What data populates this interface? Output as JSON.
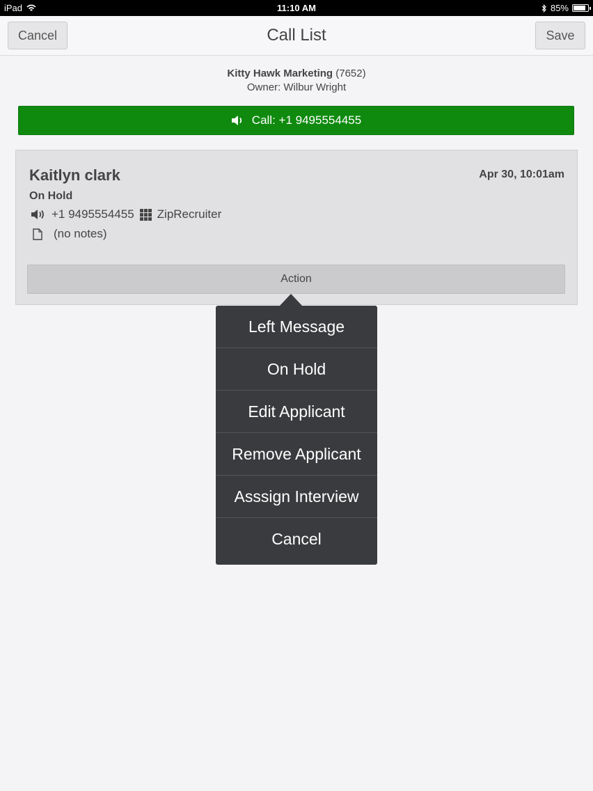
{
  "status_bar": {
    "device": "iPad",
    "time": "11:10 AM",
    "battery": "85%",
    "battery_level": 0.85
  },
  "navbar": {
    "title": "Call List",
    "cancel_label": "Cancel",
    "save_label": "Save"
  },
  "company": {
    "name": "Kitty Hawk Marketing",
    "id": "(7652)",
    "owner": "Owner: Wilbur Wright"
  },
  "call_button": {
    "label": "Call: +1 9495554455",
    "icon": "speaker-icon",
    "color": "#0f8a0f"
  },
  "contact": {
    "name": "Kaitlyn clark",
    "date": "Apr 30, 10:01am",
    "status": "On Hold",
    "phone": "+1 9495554455",
    "source": "ZipRecruiter",
    "notes": "(no notes)"
  },
  "action_button": {
    "label": "Action"
  },
  "action_menu": {
    "items": [
      {
        "label": "Left Message"
      },
      {
        "label": "On Hold"
      },
      {
        "label": "Edit Applicant"
      },
      {
        "label": "Remove Applicant"
      },
      {
        "label": "Asssign Interview"
      },
      {
        "label": "Cancel"
      }
    ]
  }
}
